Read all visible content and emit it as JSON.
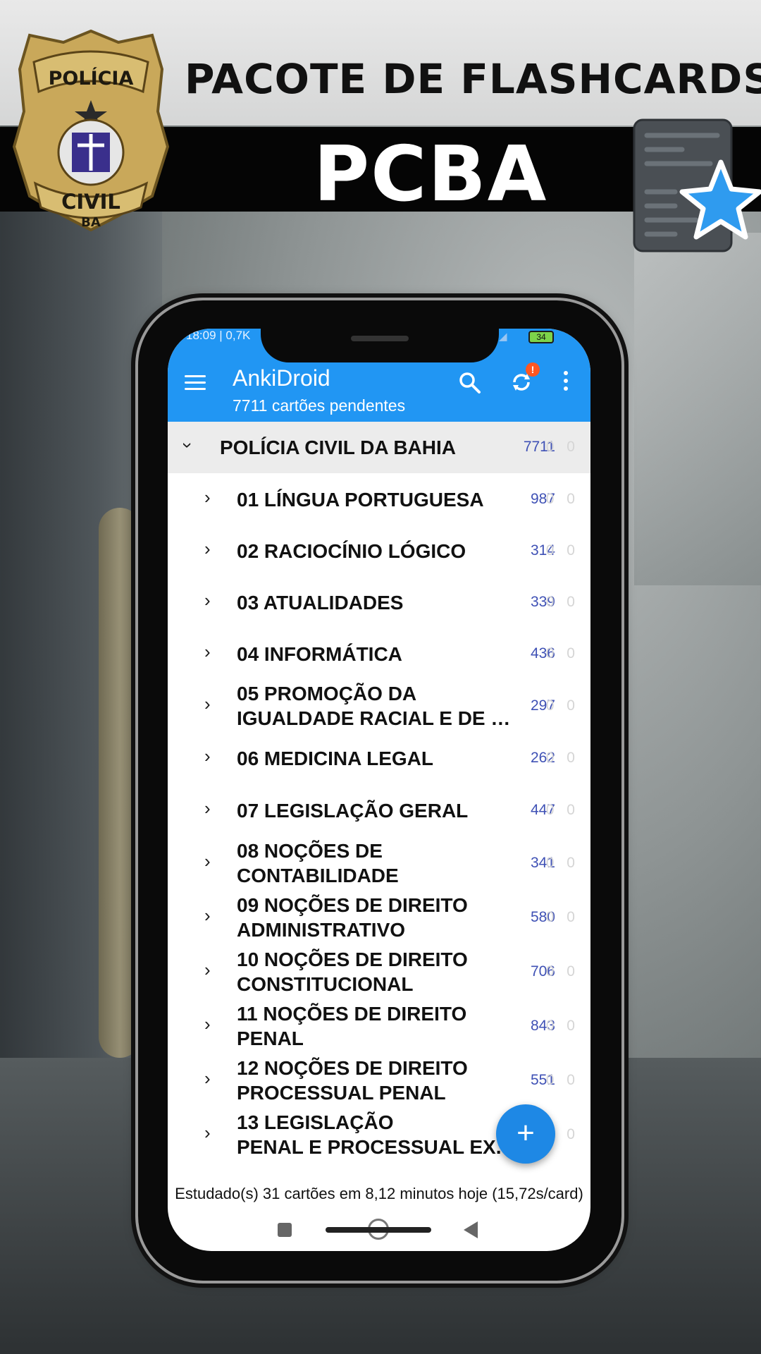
{
  "banner": {
    "title": "PACOTE DE FLASHCARDS",
    "subtitle": "PCBA",
    "badge_top": "POLÍCIA",
    "badge_bottom": "CIVIL",
    "badge_state": "BA"
  },
  "status": {
    "time": "18:09 | 0,7K",
    "battery": "34"
  },
  "appbar": {
    "title": "AnkiDroid",
    "subtitle": "7711 cartões pendentes",
    "menu_icon": "hamburger-icon",
    "search_icon": "search-icon",
    "sync_icon": "sync-icon",
    "sync_badge": "!",
    "more_icon": "more-vert-icon"
  },
  "parent_deck": {
    "name": "POLÍCIA CIVIL DA BAHIA",
    "count": "7711",
    "zeros": "0 0"
  },
  "decks": [
    {
      "line1": "01 LÍNGUA PORTUGUESA",
      "line2": "",
      "count": "987",
      "zeros": "0 0"
    },
    {
      "line1": "02 RACIOCÍNIO LÓGICO",
      "line2": "",
      "count": "314",
      "zeros": "0 0"
    },
    {
      "line1": "03 ATUALIDADES",
      "line2": "",
      "count": "339",
      "zeros": "0 0"
    },
    {
      "line1": "04 INFORMÁTICA",
      "line2": "",
      "count": "436",
      "zeros": "0 0"
    },
    {
      "line1": "05 PROMOÇÃO DA",
      "line2": "IGUALDADE RACIAL E DE …",
      "count": "297",
      "zeros": "0 0"
    },
    {
      "line1": "06 MEDICINA LEGAL",
      "line2": "",
      "count": "262",
      "zeros": "0 0"
    },
    {
      "line1": "07 LEGISLAÇÃO GERAL",
      "line2": "",
      "count": "447",
      "zeros": "0 0"
    },
    {
      "line1": "08 NOÇÕES DE",
      "line2": "CONTABILIDADE",
      "count": "341",
      "zeros": "0 0"
    },
    {
      "line1": "09 NOÇÕES DE DIREITO",
      "line2": "ADMINISTRATIVO",
      "count": "580",
      "zeros": "0 0"
    },
    {
      "line1": "10 NOÇÕES DE DIREITO",
      "line2": "CONSTITUCIONAL",
      "count": "706",
      "zeros": "0 0"
    },
    {
      "line1": "11 NOÇÕES DE DIREITO",
      "line2": "PENAL",
      "count": "843",
      "zeros": "0 0"
    },
    {
      "line1": "12 NOÇÕES DE DIREITO",
      "line2": "PROCESSUAL PENAL",
      "count": "551",
      "zeros": "0 0"
    },
    {
      "line1": "13 LEGISLAÇÃO",
      "line2": "PENAL E PROCESSUAL EX.",
      "count": "",
      "zeros": "0 0"
    }
  ],
  "fab": {
    "label": "+"
  },
  "footer": {
    "text": "Estudado(s) 31 cartões em 8,12 minutos hoje (15,72s/card)"
  }
}
